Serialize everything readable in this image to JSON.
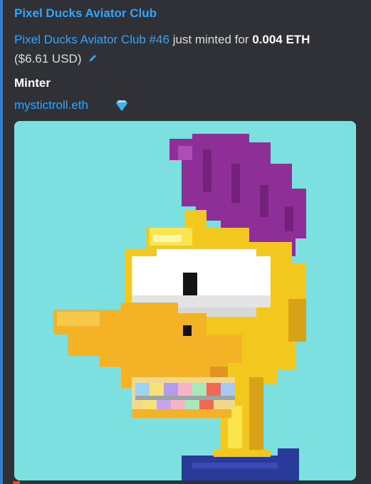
{
  "embed": {
    "title": "Pixel Ducks Aviator Club",
    "description": {
      "item_link": "Pixel Ducks Aviator Club #46",
      "text_mid": " just minted for ",
      "price": "0.004 ETH",
      "usd": "($6.61 USD)"
    },
    "field": {
      "name": "Minter",
      "value": "mystictroll.eth"
    },
    "image": {
      "alt": "pixel duck NFT"
    },
    "colors": {
      "accent": "#2f7fd6",
      "link": "#2ea7ff",
      "background": "#2f3136",
      "image_bg": "#7cdfe0"
    },
    "icons": [
      "edit-icon",
      "gem-icon"
    ]
  }
}
